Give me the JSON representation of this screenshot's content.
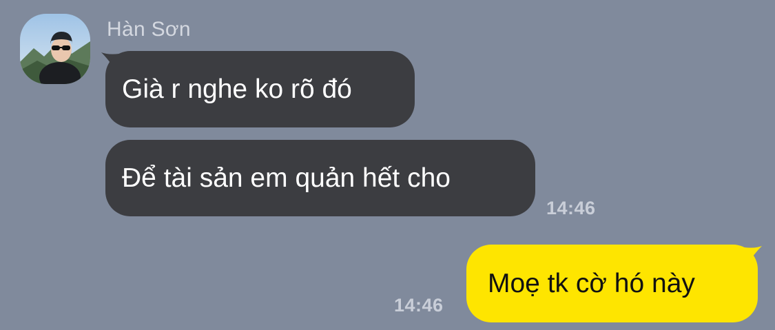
{
  "conversation": {
    "sender": {
      "name": "Hàn Sơn",
      "avatar_icon": "profile-photo"
    },
    "messages": [
      {
        "direction": "incoming",
        "text": "Già r nghe ko rõ đó"
      },
      {
        "direction": "incoming",
        "text": "Để tài sản em quản hết cho",
        "time": "14:46"
      },
      {
        "direction": "outgoing",
        "text": "Moẹ tk cờ hó này",
        "time": "14:46"
      }
    ]
  },
  "colors": {
    "background": "#808a9c",
    "incoming_bubble": "#3c3d41",
    "outgoing_bubble": "#fee500",
    "sender_name": "#d4d8e0",
    "timestamp": "#c9ced8"
  }
}
